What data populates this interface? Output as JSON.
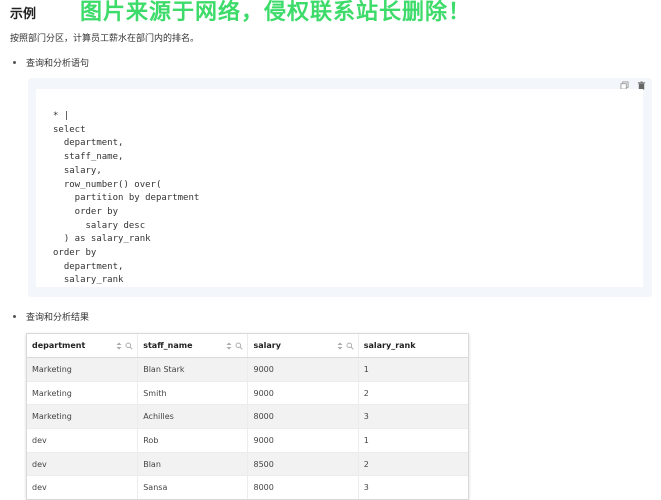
{
  "header": {
    "title": "示例",
    "watermark": "图片来源于网络，侵权联系站长删除！"
  },
  "description": "按照部门分区，计算员工薪水在部门内的排名。",
  "sections": {
    "query_label": "查询和分析语句",
    "result_label": "查询和分析结果"
  },
  "code": "* |\nselect\n  department,\n  staff_name,\n  salary,\n  row_number() over(\n    partition by department\n    order by\n      salary desc\n  ) as salary_rank\norder by\n  department,\n  salary_rank",
  "icons": [
    "copy-icon",
    "trash-icon",
    "sort-icon",
    "search-icon"
  ],
  "table": {
    "columns": [
      "department",
      "staff_name",
      "salary",
      "salary_rank"
    ],
    "rows": [
      [
        "Marketing",
        "Blan Stark",
        "9000",
        "1"
      ],
      [
        "Marketing",
        "Smith",
        "9000",
        "2"
      ],
      [
        "Marketing",
        "Achilles",
        "8000",
        "3"
      ],
      [
        "dev",
        "Rob",
        "9000",
        "1"
      ],
      [
        "dev",
        "Blan",
        "8500",
        "2"
      ],
      [
        "dev",
        "Sansa",
        "8000",
        "3"
      ]
    ]
  },
  "colors": {
    "watermark": "#3ddc6a",
    "code_bg": "#f3f6fa"
  }
}
